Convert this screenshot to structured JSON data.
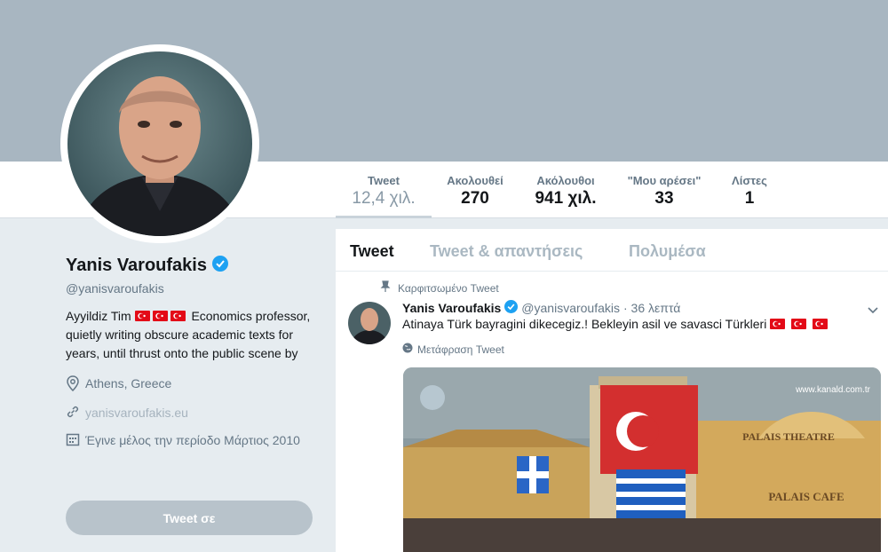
{
  "profile": {
    "name": "Yanis Varoufakis",
    "handle": "@yanisvaroufakis",
    "bio_start": "Ayyildiz Tim",
    "bio_rest": "Economics professor, quietly writing obscure academic texts for years, until thrust onto the public scene by",
    "location": "Athens, Greece",
    "website": "yanisvaroufakis.eu",
    "joined": "Έγινε μέλος την περίοδο Μάρτιος 2010",
    "tweet_to_label": "Tweet σε"
  },
  "stats": [
    {
      "label": "Tweet",
      "value": "12,4 χιλ."
    },
    {
      "label": "Ακολουθεί",
      "value": "270"
    },
    {
      "label": "Ακόλουθοι",
      "value": "941 χιλ."
    },
    {
      "label": "\"Μου αρέσει\"",
      "value": "33"
    },
    {
      "label": "Λίστες",
      "value": "1"
    }
  ],
  "tabs": [
    "Tweet",
    "Tweet & απαντήσεις",
    "Πολυμέσα"
  ],
  "tweet": {
    "pinned_label": "Καρφιτσωμένο Tweet",
    "name": "Yanis Varoufakis",
    "handle": "@yanisvaroufakis",
    "time": "· 36 λεπτά",
    "text": "Atinaya Türk bayragini dikecegiz.! Bekleyin asil ve savasci Türkleri",
    "translate_label": "Μετάφραση Tweet",
    "media_watermark": "www.kanald.com.tr",
    "media_sign_1": "PALAIS THEATRE",
    "media_sign_2": "PALAIS CAFE"
  },
  "colors": {
    "banner": "#a8b6c1",
    "verified": "#1da1f2",
    "flag_red": "#e30a17"
  }
}
